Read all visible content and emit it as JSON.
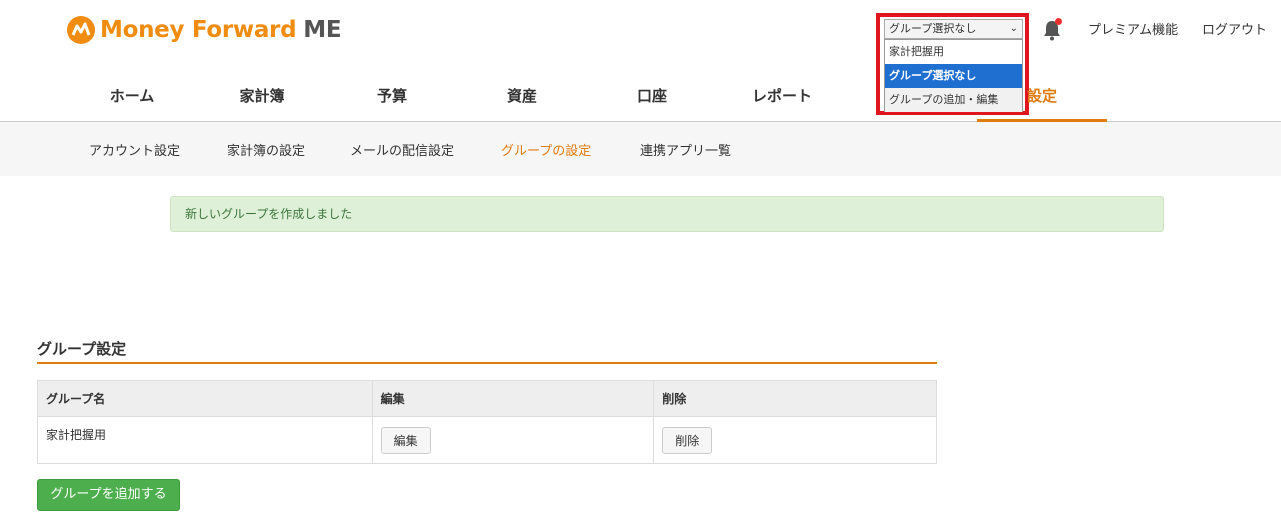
{
  "header": {
    "logo_text": "Money Forward",
    "logo_suffix": "ME",
    "group_select": {
      "value": "グループ選択なし",
      "options": [
        "家計把握用",
        "グループ選択なし",
        "グループの追加・編集"
      ]
    },
    "links": {
      "premium": "プレミアム機能",
      "logout": "ログアウト"
    }
  },
  "main_nav": [
    {
      "label": "ホーム"
    },
    {
      "label": "家計簿"
    },
    {
      "label": "予算"
    },
    {
      "label": "資産"
    },
    {
      "label": "口座"
    },
    {
      "label": "レポート"
    },
    {
      "label": "設定"
    }
  ],
  "sub_nav": [
    {
      "label": "アカウント設定"
    },
    {
      "label": "家計簿の設定"
    },
    {
      "label": "メールの配信設定"
    },
    {
      "label": "グループの設定"
    },
    {
      "label": "連携アプリ一覧"
    }
  ],
  "alert": {
    "message": "新しいグループを作成しました"
  },
  "section": {
    "title": "グループ設定",
    "table": {
      "headers": [
        "グループ名",
        "編集",
        "削除"
      ],
      "rows": [
        {
          "name": "家計把握用",
          "edit_label": "編集",
          "delete_label": "削除"
        }
      ]
    },
    "add_button": "グループを追加する"
  },
  "colors": {
    "brand": "#f08c12",
    "active_orange": "#e07b10",
    "highlight_border": "#e0151e",
    "alert_bg": "#dff0d8",
    "add_button": "#4cae4c",
    "dropdown_selected": "#1f6fd1"
  }
}
